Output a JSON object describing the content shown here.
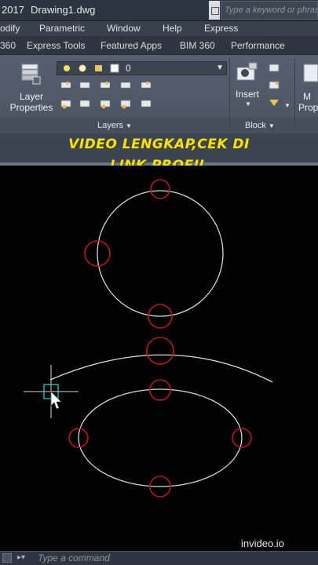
{
  "titlebar": {
    "version": "2017",
    "document": "Drawing1.dwg",
    "search_placeholder": "Type a keyword or phrase"
  },
  "menubar": {
    "items": [
      "odify",
      "Parametric",
      "Window",
      "Help",
      "Express"
    ]
  },
  "tabs": {
    "items": [
      "360",
      "Express Tools",
      "Featured Apps",
      "BIM 360",
      "Performance"
    ]
  },
  "ribbon": {
    "layer_properties_label_1": "Layer",
    "layer_properties_label_2": "Properties",
    "current_layer": "0",
    "layers_panel_title": "Layers",
    "insert_label": "Insert",
    "block_panel_title": "Block",
    "m_label_1": "M",
    "m_label_2": "Prop"
  },
  "overlay": {
    "line1": "VIDEO LENGKAP,CEK DI",
    "line2": "LINK PROFIL"
  },
  "watermark": "invideo.io",
  "command": {
    "placeholder": "Type a command"
  },
  "colors": {
    "overlay_text": "#f4e11a",
    "geometry": "#d8d8d8",
    "snap_marker": "#b01d22",
    "crosshair": "#cfd8dc",
    "pickbox": "#26c0b6"
  },
  "icons": {
    "layer_properties": "layer-stack-icon",
    "insert": "insert-block-icon",
    "close": "close-icon",
    "prompt": "command-prompt-icon",
    "search": "search-icon"
  }
}
